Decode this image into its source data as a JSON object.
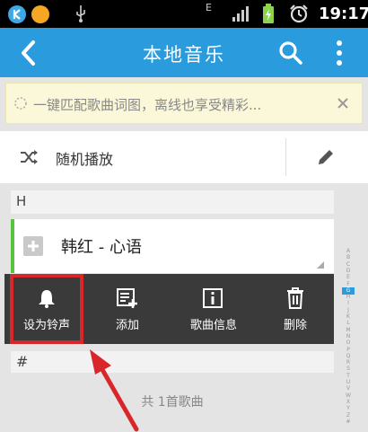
{
  "status_bar": {
    "network": "E",
    "time": "19:17"
  },
  "app_bar": {
    "title": "本地音乐"
  },
  "banner": {
    "text": "一键匹配歌曲词图，离线也享受精彩..."
  },
  "shuffle": {
    "label": "随机播放"
  },
  "sections": {
    "h": "H",
    "hash": "#"
  },
  "song": {
    "title": "韩红 - 心语"
  },
  "actions": [
    {
      "label": "设为铃声"
    },
    {
      "label": "添加"
    },
    {
      "label": "歌曲信息"
    },
    {
      "label": "删除"
    }
  ],
  "footer": {
    "count_text": "共 1首歌曲"
  },
  "index_bar": {
    "letters": [
      "A",
      "B",
      "C",
      "D",
      "E",
      "F",
      "G",
      "H",
      "I",
      "J",
      "K",
      "L",
      "M",
      "N",
      "O",
      "P",
      "Q",
      "R",
      "S",
      "T",
      "U",
      "V",
      "W",
      "X",
      "Y",
      "Z",
      "#"
    ],
    "active": "G"
  },
  "colors": {
    "app_bar": "#2a9bdc",
    "highlight": "#d9262a",
    "active_index": "#2a9bdc",
    "song_accent": "#57c23d"
  }
}
